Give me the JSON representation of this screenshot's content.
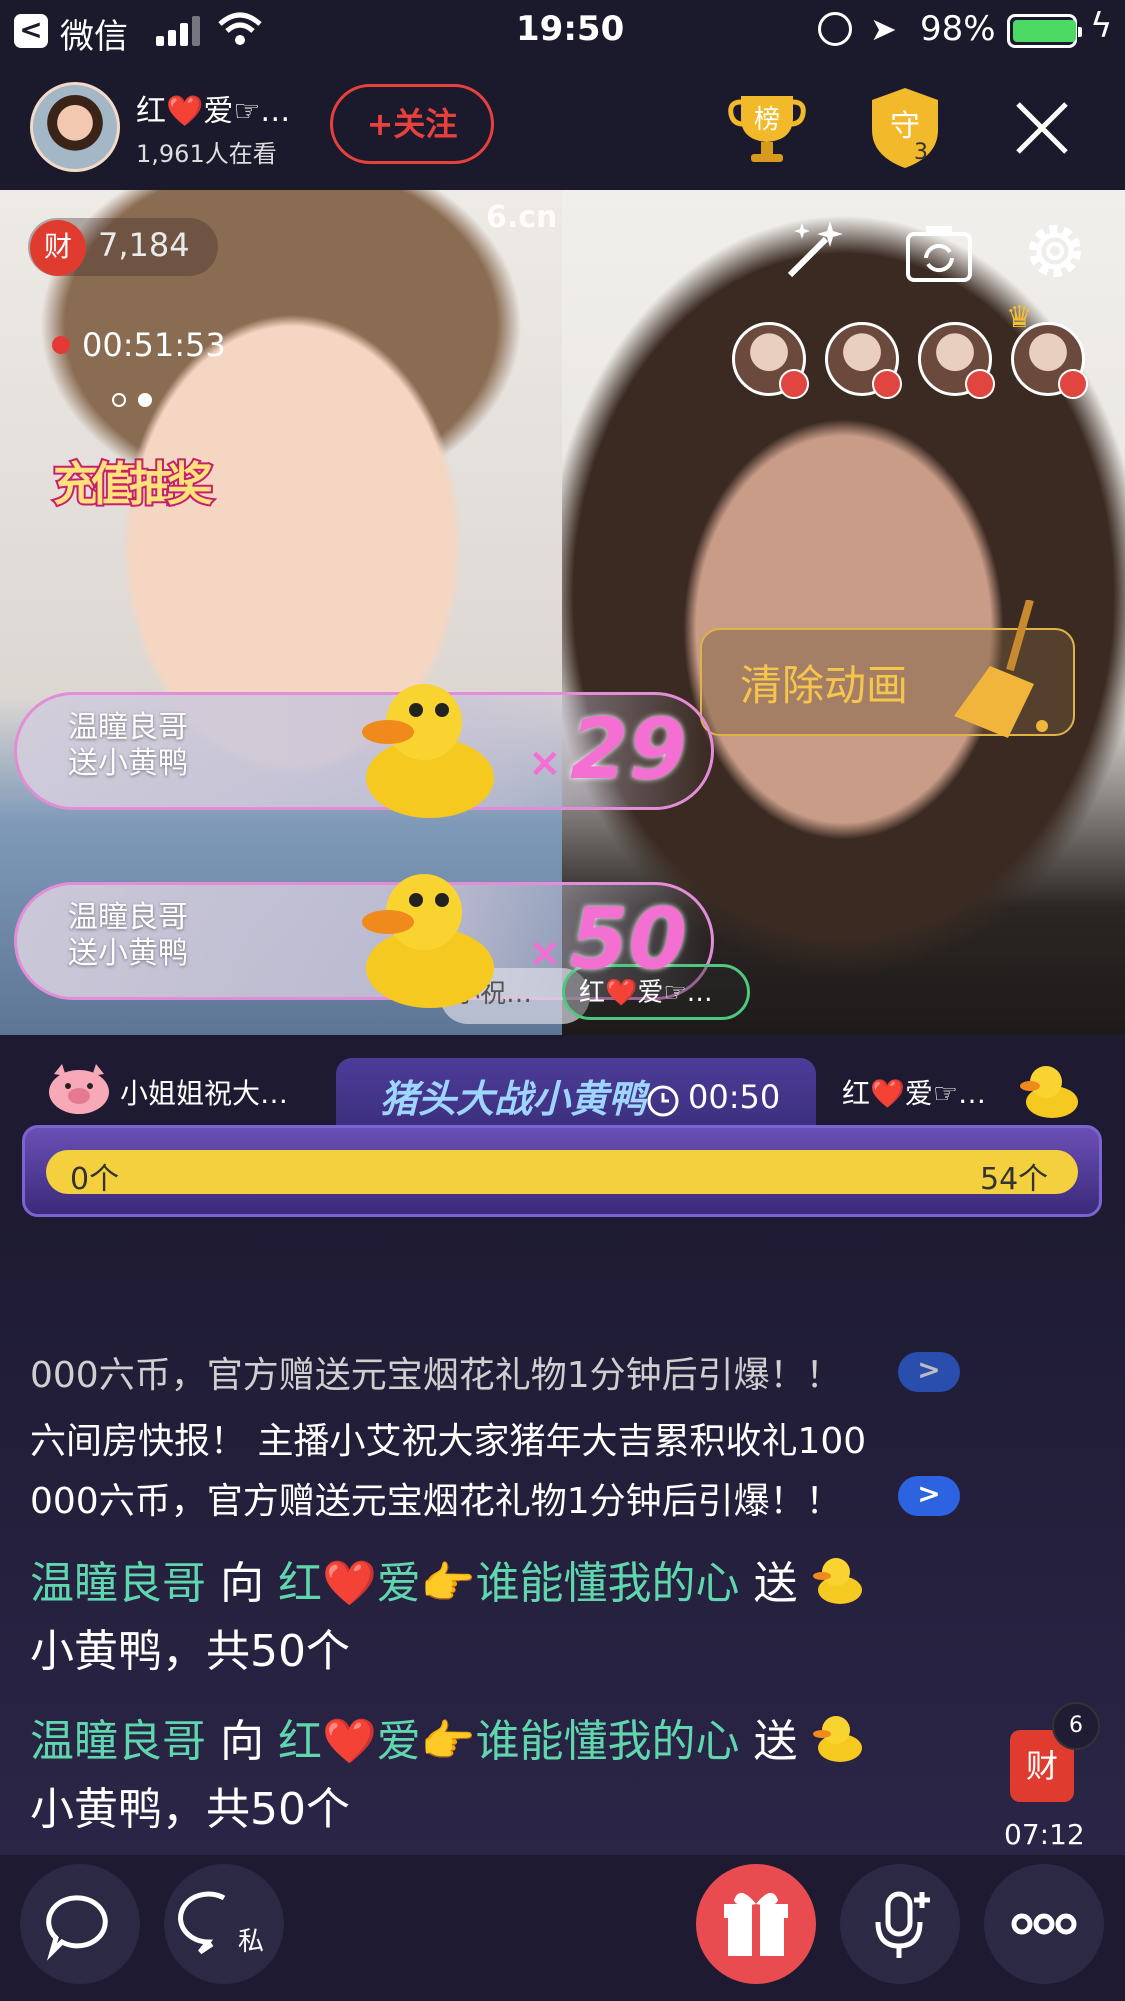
{
  "status_bar": {
    "back_app": "微信",
    "time": "19:50",
    "battery_percent": "98%",
    "battery_level": 0.98
  },
  "header": {
    "host_name": "红❤️爱☞…",
    "viewers": "1,961人在看",
    "follow_label": "+关注",
    "rank_label": "榜",
    "guard_label": "守",
    "guard_count": "3"
  },
  "stream": {
    "wealth_badge": "财",
    "wealth_value": "7,184",
    "live_timer": "00:51:53",
    "watermark": "6.cn",
    "promo_text": "充值抽奖",
    "clear_animation_label": "清除动画",
    "gift_banners": [
      {
        "line1": "温瞳良哥",
        "line2": "送小黄鸭",
        "combo": "29",
        "x": "×"
      },
      {
        "line1": "温瞳良哥",
        "line2": "送小黄鸭",
        "combo": "50",
        "x": "×"
      }
    ],
    "tag_left": "小祝…",
    "tag_right": "红❤️爱☞…"
  },
  "battle": {
    "left_name": "小姐姐祝大…",
    "title": "猪头大战小黄鸭",
    "time": "00:50",
    "right_name": "红❤️爱☞…",
    "left_count": "0个",
    "right_count": "54个"
  },
  "chat": {
    "notice1": "000六币，官方赠送元宝烟花礼物1分钟后引爆！！",
    "notice2_a": " 六间房快报！ 主播小艾祝大家猪年大吉累积收礼100",
    "notice2_b": "000六币，官方赠送元宝烟花礼物1分钟后引爆！！",
    "go_label": ">",
    "gift_msgs": [
      {
        "sender": "温瞳良哥",
        "to_word": " 向 ",
        "receiver": "红❤️爱👉谁能懂我的心",
        "send_word": " 送 ",
        "detail": " 小黄鸭，共50个"
      },
      {
        "sender": "温瞳良哥",
        "to_word": " 向 ",
        "receiver": "红❤️爱👉谁能懂我的心",
        "send_word": " 送 ",
        "detail": " 小黄鸭，共50个"
      }
    ]
  },
  "side_widget": {
    "badge": "财",
    "count": "6",
    "time": "07:12"
  },
  "bottom_bar": {
    "private_label": "私"
  }
}
